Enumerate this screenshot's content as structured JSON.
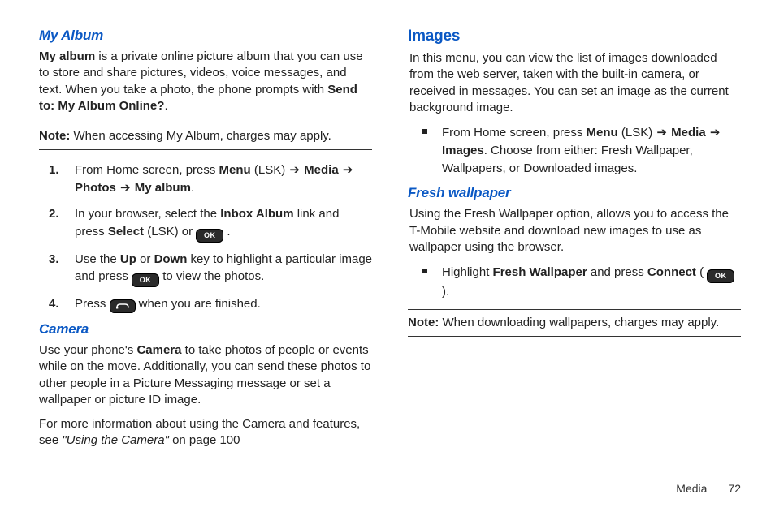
{
  "left": {
    "myAlbum": {
      "heading": "My Album",
      "para_lead": "My album",
      "para_rest": " is a private online picture album that you can use to store and share pictures, videos, voice messages, and text. When you take a photo, the phone prompts with ",
      "para_bold2": "Send to: My Album Online?",
      "para_end": ".",
      "note_label": "Note:",
      "note_text": "  When accessing My Album, charges may apply.",
      "steps": {
        "s1": {
          "num": "1.",
          "t1": "From Home screen, press ",
          "b1": "Menu",
          "t2": " (LSK) ",
          "arrow1": "➔",
          "b2": " Media ",
          "arrow2": "➔",
          "b3": " Photos ",
          "arrow3": "➔",
          "b4": " My album",
          "t3": "."
        },
        "s2": {
          "num": "2.",
          "t1": "In your browser, select the ",
          "b1": "Inbox Album",
          "t2": " link and press ",
          "b2": "Select",
          "t3": " (LSK) or  ",
          "t4": " ."
        },
        "s3": {
          "num": "3.",
          "t1": "Use the ",
          "b1": "Up",
          "t2": " or ",
          "b2": "Down",
          "t3": " key to highlight a particular image and press  ",
          "t4": "  to view the photos."
        },
        "s4": {
          "num": "4.",
          "t1": "Press  ",
          "t2": "  when you are finished."
        }
      }
    },
    "camera": {
      "heading": "Camera",
      "para1a": "Use your phone's ",
      "para1b": "Camera",
      "para1c": " to take photos of people or events while on the move. Additionally, you can send these photos to other people in a Picture Messaging message or set a wallpaper or picture ID image.",
      "para2a": "For more information about using the Camera and features, see ",
      "para2b": "\"Using the Camera\"",
      "para2c": " on page 100"
    }
  },
  "right": {
    "images": {
      "heading": "Images",
      "para": "In this menu, you can view the list of images downloaded from the web server, taken with the built-in camera, or received in messages. You can set an image as the current background image.",
      "bullet": {
        "t1": "From Home screen, press ",
        "b1": "Menu",
        "t2": " (LSK) ",
        "arrow1": "➔",
        "b2": " Media ",
        "arrow2": "➔",
        "b3": " Images",
        "t3": ". Choose from either: Fresh Wallpaper, Wallpapers, or Downloaded images."
      }
    },
    "fresh": {
      "heading": "Fresh wallpaper",
      "para": "Using the Fresh Wallpaper option, allows you to access the T-Mobile website and download new images to use as wallpaper using the browser.",
      "bullet": {
        "t1": "Highlight ",
        "b1": "Fresh Wallpaper",
        "t2": " and press ",
        "b2": "Connect",
        "t3": " ( ",
        "t4": " )."
      },
      "note_label": "Note:",
      "note_text": " When downloading wallpapers, charges may apply."
    }
  },
  "keys": {
    "ok": "OK"
  },
  "footer": {
    "section": "Media",
    "page": "72"
  }
}
